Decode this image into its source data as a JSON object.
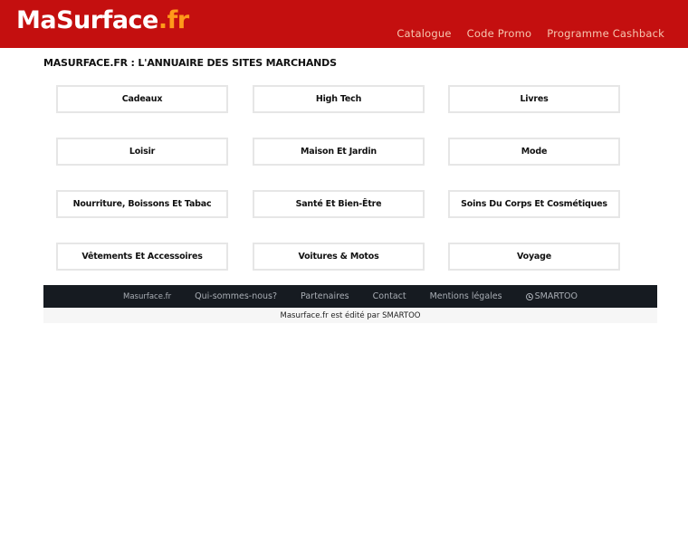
{
  "header": {
    "logo_main": "MaSurface",
    "logo_tld": ".fr",
    "nav": [
      "Catalogue",
      "Code Promo",
      "Programme Cashback"
    ]
  },
  "main": {
    "title": "MASURFACE.FR : L'ANNUAIRE DES SITES MARCHANDS",
    "categories": [
      "Cadeaux",
      "High Tech",
      "Livres",
      "Loisir",
      "Maison Et Jardin",
      "Mode",
      "Nourriture, Boissons Et Tabac",
      "Santé Et Bien-Être",
      "Soins Du Corps Et Cosmétiques",
      "Vêtements Et Accessoires",
      "Voitures & Motos",
      "Voyage"
    ]
  },
  "footer": {
    "links": [
      "Masurface.fr",
      "Qui-sommes-nous?",
      "Partenaires",
      "Contact",
      "Mentions légales"
    ],
    "brand": "SMARTOO",
    "edited_by": "Masurface.fr est édité par SMARTOO"
  },
  "colors": {
    "header_bg": "#c40f0f",
    "tld_accent": "#ff9a1a",
    "footer_bg": "#161b21"
  }
}
